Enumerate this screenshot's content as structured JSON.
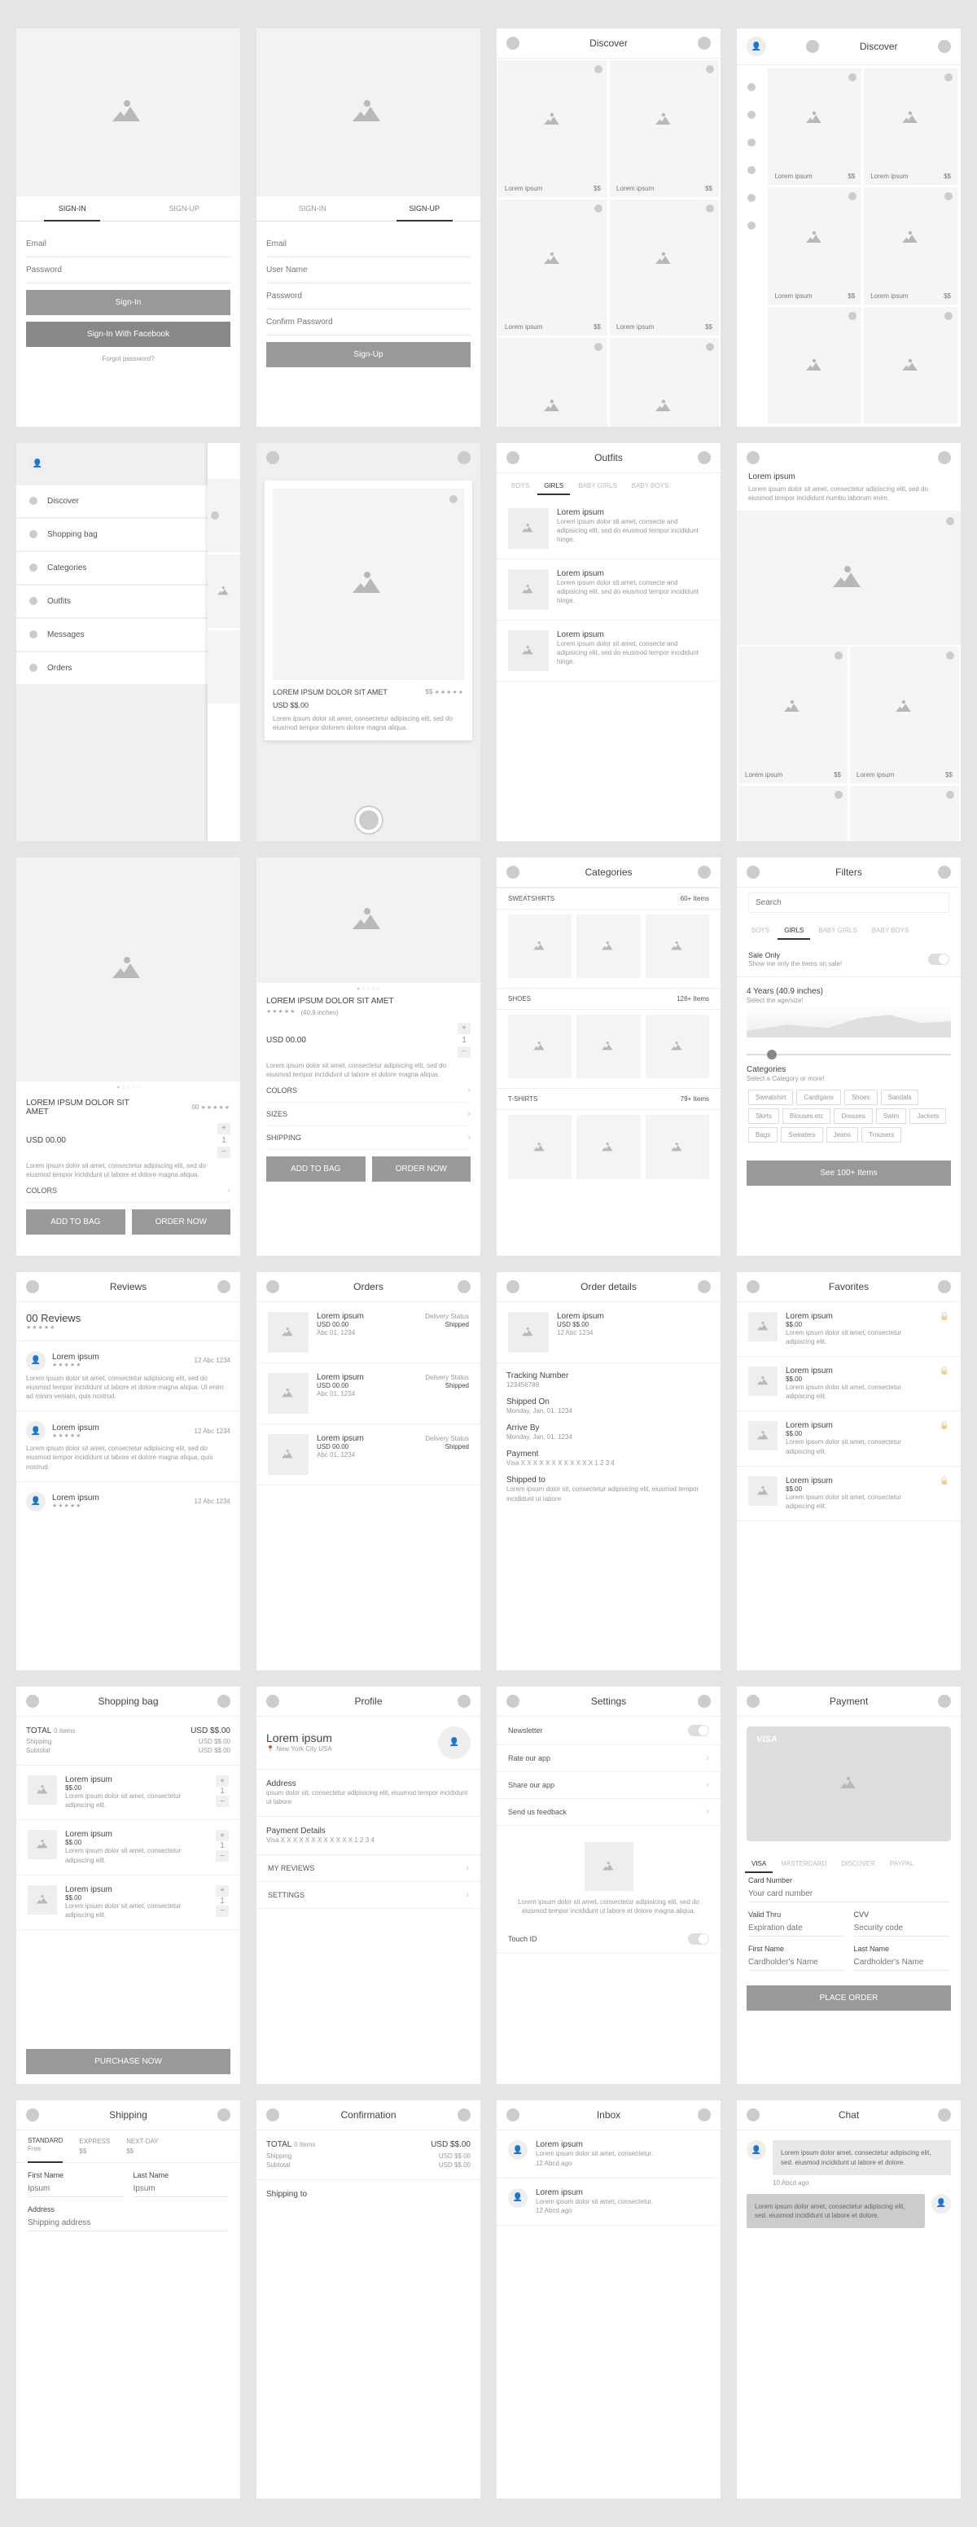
{
  "screens": {
    "signin": {
      "tabs": [
        "SIGN-IN",
        "SIGN-UP"
      ],
      "email": "Email",
      "password": "Password",
      "btn1": "Sign-In",
      "btn2": "Sign-In With Facebook",
      "forgot": "Forgot password?"
    },
    "signup": {
      "tabs": [
        "SIGN-IN",
        "SIGN-UP"
      ],
      "email": "Email",
      "user": "User Name",
      "password": "Password",
      "confirm": "Confirm Password",
      "btn": "Sign-Up"
    },
    "discover": {
      "title": "Discover",
      "item": "Lorem ipsum",
      "price": "$$"
    },
    "menu": {
      "items": [
        "Discover",
        "Shopping bag",
        "Categories",
        "Outfits",
        "Messages",
        "Orders"
      ]
    },
    "swipe": {
      "title": "LOREM IPSUM DOLOR SIT AMET",
      "likes": "$$",
      "price": "USD $$.00",
      "desc": "Lorem ipsum dolor sit amet, consectetur adipiscing elit, sed do eiusmod tempor dolorem dolore magna aliqua."
    },
    "outfits": {
      "title": "Outfits",
      "tabs": [
        "BOYS",
        "GIRLS",
        "BABY GIRLS",
        "BABY BOYS"
      ],
      "active": 1,
      "item_title": "Lorem ipsum",
      "item_desc": "Lorem ipsum dolor sit amet, consecte and adipisicing elit, sed do eiusmod tempor incididunt hinge."
    },
    "outfit_detail": {
      "item_title": "Lorem ipsum",
      "item_desc": "Lorem ipsum dolor sit amet, consectetur adipiscing elit, sed do eiusmod tempor incididunt numbu laborum enim.",
      "item": "Lorem ipsum",
      "price": "$$"
    },
    "product": {
      "title": "LOREM IPSUM DOLOR SIT AMET",
      "reviews": "00",
      "price": "USD 00.00",
      "desc": "Lorem ipsum dolor sit amet, consectetur adipiscing elit, sed do eiusmod tempor incididunt ut labore et dolore magna aliqua.",
      "colors": "COLORS",
      "sizes": "SIZES",
      "shipping": "SHIPPING",
      "inches": "(40.9 inches)",
      "add": "ADD TO BAG",
      "order": "ORDER NOW"
    },
    "categories": {
      "title": "Categories",
      "sections": [
        {
          "name": "SWEATSHIRTS",
          "count": "60+ Items"
        },
        {
          "name": "SHOES",
          "count": "126+ Items"
        },
        {
          "name": "T-SHIRTS",
          "count": "79+ Items"
        }
      ]
    },
    "filters": {
      "title": "Filters",
      "search": "Search",
      "tabs": [
        "BOYS",
        "GIRLS",
        "BABY GIRLS",
        "BABY BOYS"
      ],
      "sale": "Sale Only",
      "sale_sub": "Show me only the items on sale!",
      "age": "4 Years (40.9 inches)",
      "age_sub": "Select the age/size!",
      "cat_head": "Categories",
      "cat_sub": "Select a Category or more!",
      "tags": [
        "Sweatshirt",
        "Cardigans",
        "Shoes",
        "Sandals",
        "Skirts",
        "Blouses etc",
        "Dresses",
        "Swim",
        "Jackets",
        "Bags",
        "Sweaters",
        "Jeans",
        "Trousers"
      ],
      "btn": "See 100+ Items"
    },
    "reviews": {
      "title": "Reviews",
      "count": "00 Reviews",
      "user": "Lorem ipsum",
      "date": "12 Abc 1234",
      "body": "Lorem ipsum dolor sit amet, consectetur adipisicing elit, sed do eiusmod tempor incididunt ut labore et dolore magna aliqua. Ut enim ad minim veniam, quis nostrud.",
      "body2": "Lorem ipsum dolor sit amet, consectetur adipisicing elit, sed do eiusmod tempor incididunt ut labore et dolore magna aliqua, quis nostrud."
    },
    "orders": {
      "title": "Orders",
      "name": "Lorem ipsum",
      "price": "USD 00.00",
      "sku": "Abc 01, 1234",
      "status_label": "Delivery Status",
      "status": "Shipped"
    },
    "order_detail": {
      "title": "Order details",
      "name": "Lorem ipsum",
      "price": "USD $$.00",
      "date": "12 Abc 1234",
      "track": "Tracking Number",
      "track_val": "123456789",
      "ship_on": "Shipped On",
      "ship_on_val": "Monday, Jan, 01. 1234",
      "arrive": "Arrive By",
      "arrive_val": "Monday, Jan, 01. 1234",
      "pay": "Payment",
      "pay_val": "Visa  X X X X  X X X X  X X X X  1 2 3 4",
      "ship_to": "Shipped to",
      "ship_to_val": "Lorem ipsum dolor sit, consectetur adipisicing elit, eiusmod tempor incididunt ut labore"
    },
    "favorites": {
      "title": "Favorites",
      "name": "Lorem ipsum",
      "price": "$$.00",
      "desc": "Lorem ipsum dolor sit amet, consectetur adipiscing elit."
    },
    "bag": {
      "title": "Shopping bag",
      "total": "TOTAL",
      "items": "0 Items",
      "total_val": "USD $$.00",
      "shipping": "Shipping",
      "subtotal": "Subtotal",
      "sub_val": "USD $$.00",
      "name": "Lorem ipsum",
      "price": "$$.00",
      "desc": "Lorem ipsum dolor sit amet, consectetur adipiscing elit.",
      "btn": "PURCHASE NOW"
    },
    "profile": {
      "title": "Profile",
      "name": "Lorem ipsum",
      "loc": "New York City USA",
      "addr": "Address",
      "addr_val": "ipsum dolor sit, consectetur adipisicing elit, eiusmod tempor incididunt ut labore",
      "pay": "Payment Details",
      "pay_val": "Visa  X X X X  X X X X  X X X X  1 2 3 4",
      "rev": "MY REVIEWS",
      "set": "SETTINGS"
    },
    "settings": {
      "title": "Settings",
      "news": "Newsletter",
      "rate": "Rate our app",
      "share": "Share our app",
      "feedback": "Send us feedback",
      "about": "Lorem ipsum dolor sit amet, consectetur adipisicing elit, sed do eiusmod tempor incididunt ut labore et dolore magna aliqua.",
      "touch": "Touch ID"
    },
    "payment": {
      "title": "Payment",
      "visa": "VISA",
      "tabs": [
        "VISA",
        "MASTERCARD",
        "DISCOVER",
        "PAYPAL"
      ],
      "card_num": "Card Number",
      "card_ph": "Your card number",
      "valid": "Valid Thru",
      "valid_ph": "Expiration date",
      "cvv": "CVV",
      "cvv_ph": "Security code",
      "fname": "First Name",
      "fname_ph": "Cardholder's Name",
      "lname": "Last Name",
      "lname_ph": "Cardholder's Name",
      "btn": "PLACE ORDER"
    },
    "shipping": {
      "title": "Shipping",
      "tabs": [
        {
          "n": "STANDARD",
          "p": "Free"
        },
        {
          "n": "EXPRESS",
          "p": "$$"
        },
        {
          "n": "NEXT-DAY",
          "p": "$$"
        }
      ],
      "fname": "First Name",
      "lname": "Last Name",
      "ipsum": "Ipsum",
      "addr": "Address",
      "addr_ph": "Shipping address"
    },
    "confirm": {
      "title": "Confirmation",
      "total": "TOTAL",
      "items": "0 Items",
      "price": "USD $$.00",
      "ship": "Shipping",
      "sub": "Subtotal",
      "ship_to": "Shipping to"
    },
    "inbox": {
      "title": "Inbox",
      "name": "Lorem ipsum",
      "desc": "Lorem ipsum dolor sit amet, consectetur.",
      "time": "12 Abcd ago"
    },
    "chat": {
      "title": "Chat",
      "msg": "Lorem ipsum dolor amet, consectetur adipiscing elit, sed. eiusmod incididunt ut labore et dolore.",
      "time": "10 Abcd ago"
    }
  }
}
